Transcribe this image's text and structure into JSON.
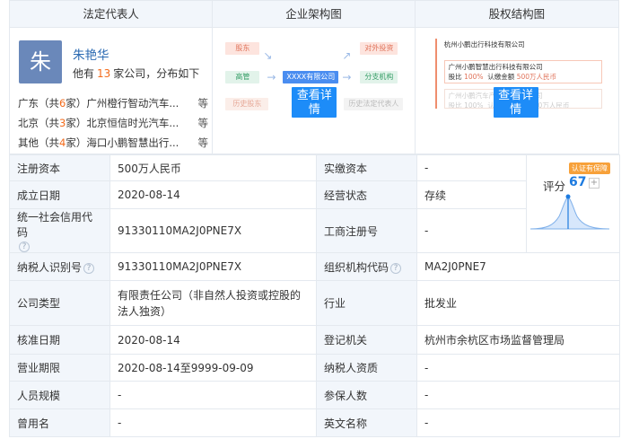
{
  "headers": {
    "legal_rep": "法定代表人",
    "org_chart": "企业架构图",
    "equity_chart": "股权结构图"
  },
  "legal_rep": {
    "avatar_char": "朱",
    "name": "朱艳华",
    "summary_prefix": "他有",
    "company_count": "13",
    "summary_suffix": "家公司，分布如下",
    "regions": [
      {
        "region": "广东（共",
        "count": "6",
        "unit": "家）",
        "company": "广州橙行智动汽车...",
        "more": "等"
      },
      {
        "region": "北京（共",
        "count": "3",
        "unit": "家）",
        "company": "北京恒信时光汽车...",
        "more": "等"
      },
      {
        "region": "其他（共",
        "count": "4",
        "unit": "家）",
        "company": "海口小鹏智慧出行...",
        "more": "等"
      }
    ]
  },
  "org_diagram": {
    "shareholder": "股东",
    "executive": "高管",
    "history_shareholder": "历史股东",
    "center": "XXXX有限公司",
    "investment": "对外投资",
    "branch": "分支机构",
    "history_rep": "历史法定代表人",
    "button": "查看详情"
  },
  "equity_diagram": {
    "root": "杭州小鹏出行科技有限公司",
    "node1_name": "广州小鹏智慧出行科技有限公司",
    "node1_ratio_label": "股比",
    "node1_ratio": "100%",
    "node1_amount_label": "认缴金额",
    "node1_amount": "500万人民币",
    "node2_name": "广州小鹏汽车产业控股有限公司",
    "node2_ratio_label": "股比",
    "node2_ratio": "100%",
    "node2_amount_label": "认缴金额",
    "node2_amount": "250000万人民币",
    "button": "查看详情"
  },
  "score": {
    "badge": "认证有保障",
    "label": "评分",
    "value": "67",
    "plus": "+"
  },
  "table": {
    "registered_capital_label": "注册资本",
    "registered_capital": "500万人民币",
    "paid_capital_label": "实缴资本",
    "paid_capital": "-",
    "founded_label": "成立日期",
    "founded": "2020-08-14",
    "status_label": "经营状态",
    "status": "存续",
    "credit_code_label": "统一社会信用代码",
    "credit_code": "91330110MA2J0PNE7X",
    "biz_reg_label": "工商注册号",
    "biz_reg": "-",
    "taxpayer_id_label": "纳税人识别号",
    "taxpayer_id": "91330110MA2J0PNE7X",
    "org_code_label": "组织机构代码",
    "org_code": "MA2J0PNE7",
    "company_type_label": "公司类型",
    "company_type": "有限责任公司（非自然人投资或控股的法人独资）",
    "industry_label": "行业",
    "industry": "批发业",
    "approval_date_label": "核准日期",
    "approval_date": "2020-08-14",
    "reg_authority_label": "登记机关",
    "reg_authority": "杭州市余杭区市场监督管理局",
    "biz_term_label": "营业期限",
    "biz_term": "2020-08-14至9999-09-09",
    "taxpayer_qual_label": "纳税人资质",
    "taxpayer_qual": "-",
    "staff_label": "人员规模",
    "staff": "-",
    "insured_label": "参保人数",
    "insured": "-",
    "former_name_label": "曾用名",
    "former_name": "-",
    "english_name_label": "英文名称",
    "english_name": "-"
  },
  "colors": {
    "accent": "#1d8cf8",
    "highlight": "#f36b1b",
    "link": "#2b6ab2",
    "label_bg": "#f2f6fb"
  }
}
